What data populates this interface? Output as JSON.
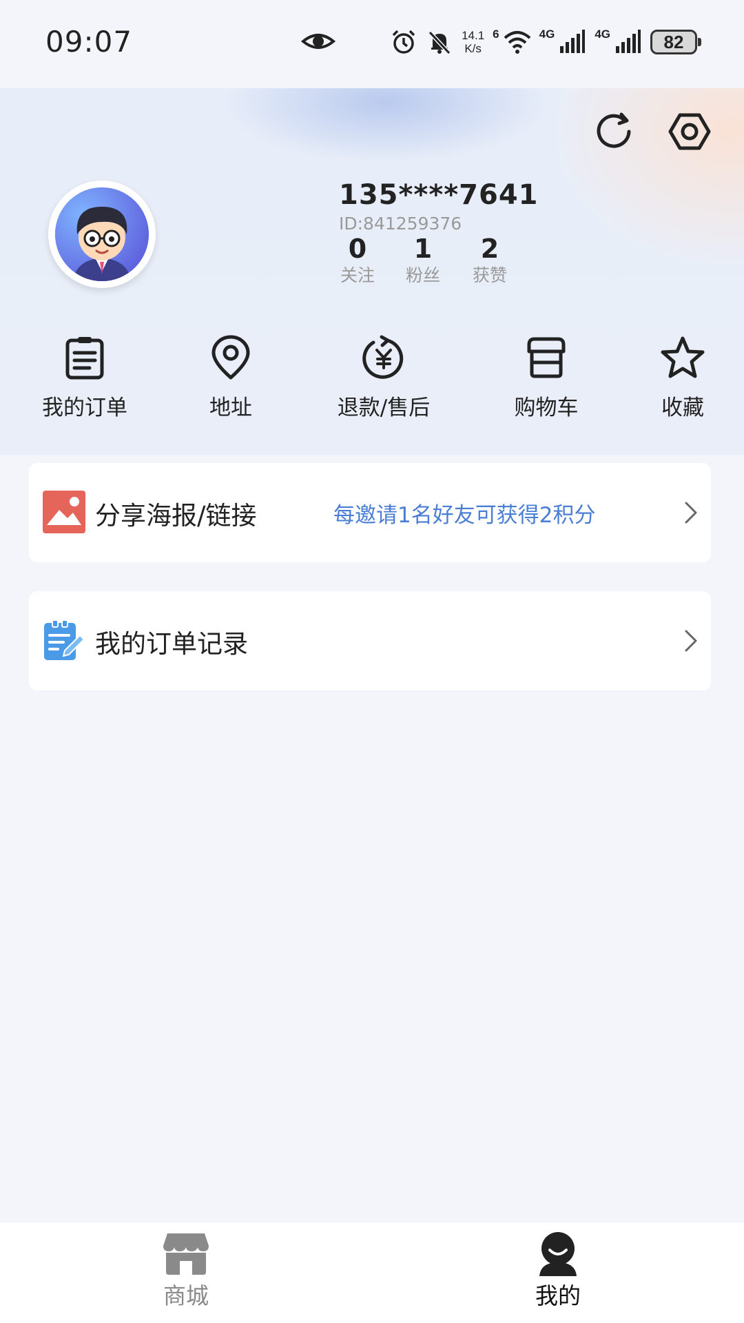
{
  "status_bar": {
    "time": "09:07",
    "net_speed_value": "14.1",
    "net_speed_unit": "K/s",
    "wifi_label": "6",
    "sim1_label": "4G",
    "sim2_label": "4G",
    "battery": "82",
    "icons": [
      "eye-icon",
      "alarm-icon",
      "mute-icon",
      "wifi-icon",
      "signal-icon",
      "battery-icon"
    ]
  },
  "header": {
    "phone": "135****7641",
    "user_id": "ID:841259376",
    "stats": {
      "follow": {
        "value": "0",
        "label": "关注"
      },
      "fans": {
        "value": "1",
        "label": "粉丝"
      },
      "likes": {
        "value": "2",
        "label": "获赞"
      }
    },
    "actions": [
      "refresh-icon",
      "settings-icon"
    ]
  },
  "quick_actions": [
    {
      "label": "我的订单",
      "icon": "clipboard-icon"
    },
    {
      "label": "地址",
      "icon": "location-pin-icon"
    },
    {
      "label": "退款/售后",
      "icon": "refund-icon"
    },
    {
      "label": "购物车",
      "icon": "store-box-icon"
    },
    {
      "label": "收藏",
      "icon": "star-icon"
    }
  ],
  "cards": {
    "share": {
      "title": "分享海报/链接",
      "hint": "每邀请1名好友可获得2积分",
      "icon": "image-icon"
    },
    "orders": {
      "title": "我的订单记录",
      "icon": "notepad-edit-icon"
    }
  },
  "bottom_nav": [
    {
      "label": "商城",
      "icon": "shop-icon",
      "active": false
    },
    {
      "label": "我的",
      "icon": "user-icon",
      "active": true
    }
  ],
  "colors": {
    "accent_blue": "#4a7ed6",
    "share_icon_red": "#e5655a",
    "orders_icon_blue": "#4b9ae8",
    "background": "#f3f5fa"
  }
}
